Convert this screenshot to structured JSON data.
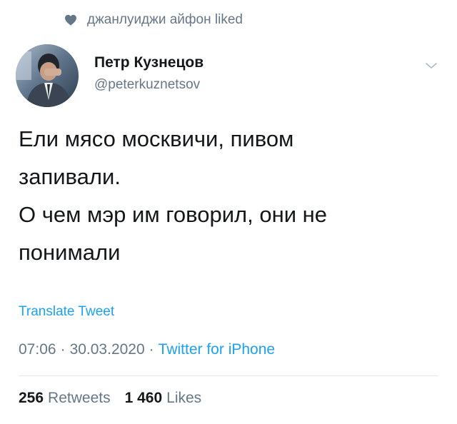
{
  "social_context": {
    "text": "джанлуиджи айфон liked",
    "icon": "heart-icon"
  },
  "author": {
    "name": "Петр Кузнецов",
    "handle": "@peterkuznetsov"
  },
  "tweet": {
    "lines": [
      "Ели мясо москвичи, пивом",
      "запивали.",
      "О чем мэр им говорил, они не",
      "понимали"
    ],
    "translate_label": "Translate Tweet",
    "time": "07:06",
    "separator": "·",
    "date": "30.03.2020",
    "source": "Twitter for iPhone"
  },
  "stats": {
    "retweets_count": "256",
    "retweets_label": "Retweets",
    "likes_count": "1 460",
    "likes_label": "Likes"
  },
  "colors": {
    "link": "#1da1f2",
    "secondary": "#657786",
    "primary_text": "#14171a"
  }
}
